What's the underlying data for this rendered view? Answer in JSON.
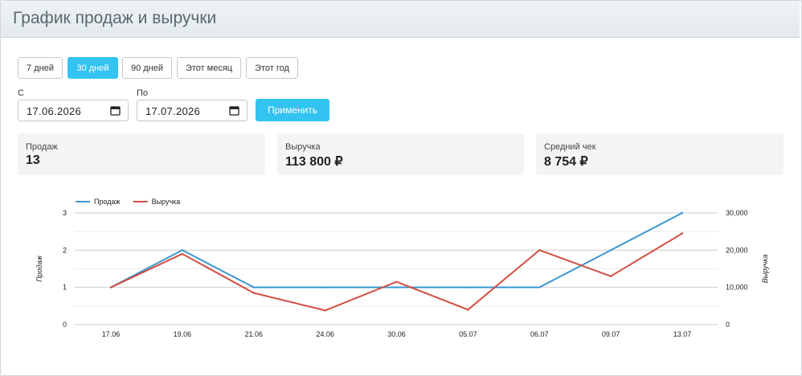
{
  "page": {
    "title": "График продаж и выручки"
  },
  "filters": {
    "periods": [
      {
        "label": "7 дней",
        "active": false
      },
      {
        "label": "30 дней",
        "active": true
      },
      {
        "label": "90 дней",
        "active": false
      },
      {
        "label": "Этот месяц",
        "active": false
      },
      {
        "label": "Этот год",
        "active": false
      }
    ],
    "from_label": "С",
    "from_value": "17.06.2026",
    "to_label": "По",
    "to_value": "17.07.2026",
    "apply_label": "Применить"
  },
  "stats": [
    {
      "label": "Продаж",
      "value": "13"
    },
    {
      "label": "Выручка",
      "value": "113 800 ₽"
    },
    {
      "label": "Средний чек",
      "value": "8 754 ₽"
    }
  ],
  "colors": {
    "accent": "#33c3f0",
    "sales": "#3a96d1",
    "revenue": "#d24f42"
  },
  "chart_data": {
    "type": "line",
    "categories": [
      "17.06",
      "19.06",
      "21.06",
      "24.06",
      "30.06",
      "05.07",
      "06.07",
      "09.07",
      "13.07"
    ],
    "series": [
      {
        "name": "Продаж",
        "axis": "left",
        "color": "#3a96d1",
        "values": [
          1,
          2,
          1,
          1,
          1,
          1,
          1,
          2,
          3
        ]
      },
      {
        "name": "Выручка",
        "axis": "right",
        "color": "#d24f42",
        "values": [
          10000,
          19000,
          8500,
          3800,
          11500,
          4000,
          20000,
          13000,
          24500
        ]
      }
    ],
    "ylabel_left": "Продаж",
    "ylabel_right": "Выручка",
    "ylim_left": [
      0,
      3
    ],
    "ylim_right": [
      0,
      30000
    ],
    "yticks_left": [
      "0",
      "1",
      "2",
      "3"
    ],
    "yticks_right": [
      "0",
      "10,000",
      "20,000",
      "30,000"
    ],
    "grid": true,
    "legend": "top-left"
  }
}
